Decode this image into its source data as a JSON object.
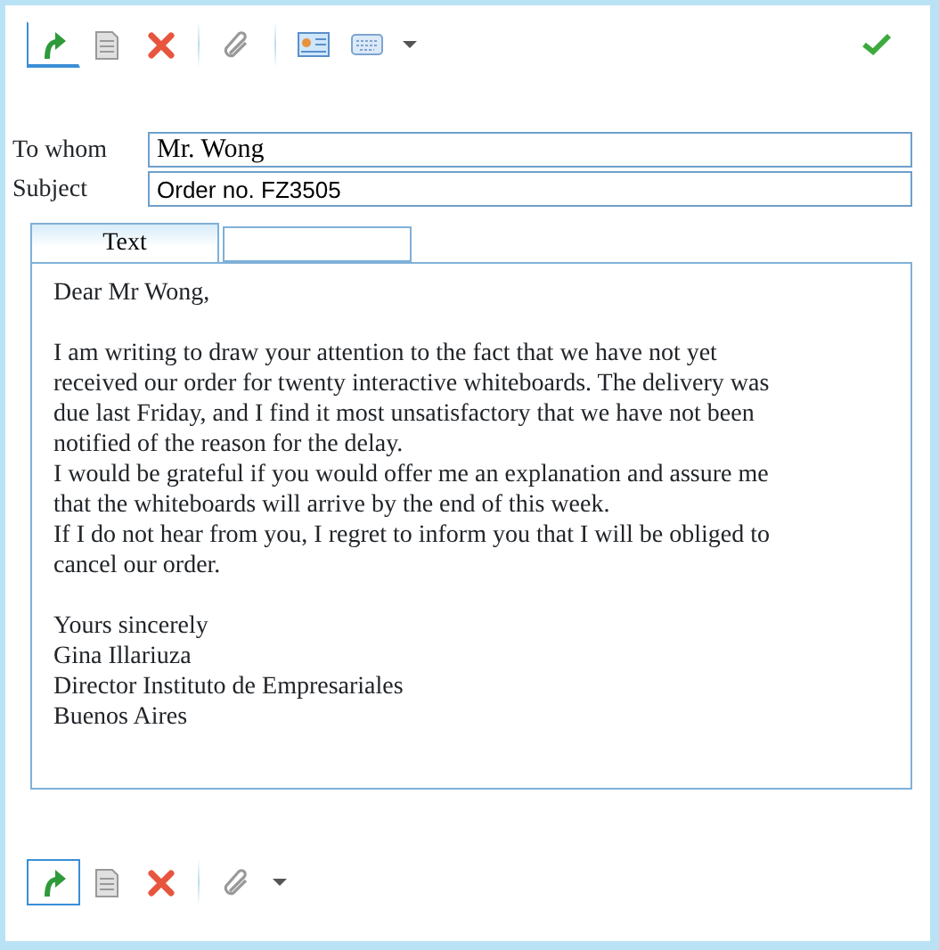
{
  "top_toolbar": {
    "items": [
      {
        "kind": "reply",
        "selected": true
      },
      {
        "kind": "document",
        "selected": false
      },
      {
        "kind": "delete",
        "selected": false
      },
      {
        "kind": "separator"
      },
      {
        "kind": "attach",
        "selected": false
      },
      {
        "kind": "separator"
      },
      {
        "kind": "contact",
        "selected": false
      },
      {
        "kind": "keyboard",
        "selected": false
      },
      {
        "kind": "caret",
        "selected": false
      }
    ],
    "confirm": {
      "kind": "check"
    }
  },
  "fields": [
    {
      "label": "To whom",
      "value": "Mr. Wong",
      "kind": "serif"
    },
    {
      "label": "Subject",
      "value": "Order no. FZ3505",
      "kind": "sans"
    }
  ],
  "tabs": [
    {
      "label": "Text",
      "selected": true
    },
    {
      "selected": false
    }
  ],
  "letter": [
    {
      "paragraphs": [
        [
          "Dear Mr Wong,"
        ]
      ]
    },
    {
      "paragraphs": [
        [
          "I am writing to draw your attention to the fact that we have not yet",
          "received our order for twenty interactive whiteboards. The delivery was",
          "due last Friday, and I find it most unsatisfactory that we have not been",
          "notified of the reason for the delay."
        ],
        [
          "I would be grateful if you would offer me an explanation and assure me",
          "that the whiteboards will arrive by the end of this week."
        ],
        [
          "If I do not hear from you, I regret to inform you that I will be obliged to",
          "cancel our order."
        ]
      ]
    },
    {
      "paragraphs": [
        [
          "Yours sincerely",
          "Gina Illariuza",
          "Director Instituto de Empresariales",
          "Buenos Aires"
        ]
      ]
    }
  ],
  "bottom_toolbar": {
    "items": [
      {
        "kind": "reply",
        "selected": true
      },
      {
        "kind": "document",
        "selected": false
      },
      {
        "kind": "delete",
        "selected": false
      },
      {
        "kind": "separator"
      },
      {
        "kind": "attach",
        "selected": false
      },
      {
        "kind": "caret",
        "selected": false
      }
    ]
  }
}
